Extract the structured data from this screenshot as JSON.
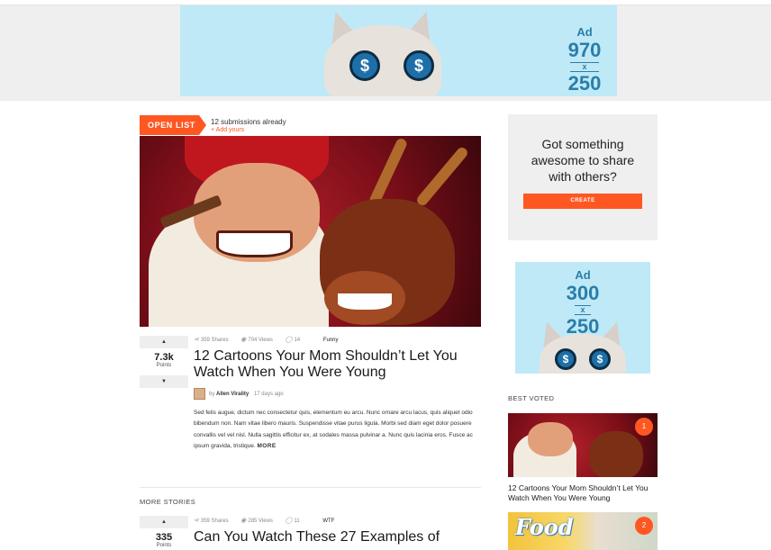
{
  "ads": {
    "leaderboard": {
      "label": "Ad",
      "w": "970",
      "x": "x",
      "h": "250"
    },
    "rectangle": {
      "label": "Ad",
      "w": "300",
      "x": "x",
      "h": "250"
    },
    "cat_eye_symbol": "$"
  },
  "open_list": {
    "badge": "OPEN LIST",
    "submissions": "12 submissions already",
    "add_link": "+ Add yours"
  },
  "main_post": {
    "points": "7.3k",
    "points_label": "Points",
    "shares": "359 Shares",
    "views": "704 Views",
    "comments": "14",
    "category": "Funny",
    "title": "12 Cartoons Your Mom Shouldn’t Let You Watch When You Were Young",
    "author_prefix": "by",
    "author": "Allen Virality",
    "time": "17 days ago",
    "excerpt": "Sed felis augue, dictum nec consectetur quis, elementum eu arcu. Nunc ornare arcu lacus, quis aliquet odio bibendum non. Nam vitae libero mauris. Suspendisse vitae purus ligula. Morbi sed diam eget dolor posuere convallis vel vel nisl. Nulla sagittis efficitur ex, at sodales massa pulvinar a. Nunc quis lacinia eros. Fusce ac ipsum gravida, tristique.",
    "more": "MORE"
  },
  "more_stories": {
    "heading": "MORE STORIES",
    "post": {
      "points": "335",
      "points_label": "Points",
      "shares": "359 Shares",
      "views": "285 Views",
      "comments": "11",
      "category": "WTF",
      "title": "Can You Watch These 27 Examples of"
    }
  },
  "sidebar": {
    "cta_question": "Got something awesome to share with others?",
    "cta_button": "CREATE",
    "best_voted_heading": "BEST VOTED",
    "items": [
      {
        "rank": "1",
        "title": "12 Cartoons Your Mom Shouldn’t Let You Watch When You Were Young"
      },
      {
        "rank": "2",
        "thumb_text": "Food"
      }
    ]
  },
  "icons": {
    "vote_up": "▲",
    "vote_down": "▼",
    "share": "⋖",
    "view": "◉",
    "comment": "◯"
  },
  "colors": {
    "accent": "#ff5722",
    "ad_bg": "#bfe9f7",
    "ad_text": "#2a7ea8",
    "panel_bg": "#efefef"
  }
}
